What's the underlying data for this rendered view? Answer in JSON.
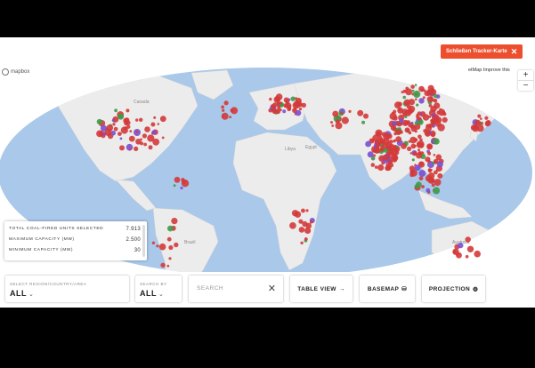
{
  "close_button": {
    "label": "Schließen Tracker-Karte",
    "icon": "close-icon"
  },
  "map": {
    "logo_text": "mapbox",
    "attribution": "etMap  Improve this",
    "zoom_in": "+",
    "zoom_out": "−",
    "place_labels": [
      "Canada",
      "Libya",
      "Egypt",
      "Brazil",
      "Australia"
    ]
  },
  "stats": [
    {
      "label": "TOTAL COAL-FIRED UNITS SELECTED",
      "value": "7.913"
    },
    {
      "label": "MAXIMUM CAPACITY (MW)",
      "value": "2.500"
    },
    {
      "label": "MINIMUM CAPACITY (MW)",
      "value": "30"
    }
  ],
  "controls": {
    "region": {
      "label": "SELECT REGION/COUNTRY/AREA",
      "value": "ALL",
      "caret": "⌄"
    },
    "search_by": {
      "label": "SEARCH BY",
      "value": "ALL",
      "caret": "⌄"
    },
    "search": {
      "placeholder": "SEARCH",
      "clear": "✕"
    },
    "table_view": {
      "label": "TABLE VIEW",
      "icon": "→"
    },
    "basemap": {
      "label": "BASEMAP",
      "icon": "⛁"
    },
    "projection": {
      "label": "PROJECTION",
      "icon": "◍"
    }
  },
  "colors": {
    "map_water": "#a9c8ea",
    "map_land": "#ececec",
    "operating": "#d43a3a",
    "construction": "#7a4fd0",
    "proposed": "#3f9a46",
    "accent": "#ec4f2d"
  }
}
